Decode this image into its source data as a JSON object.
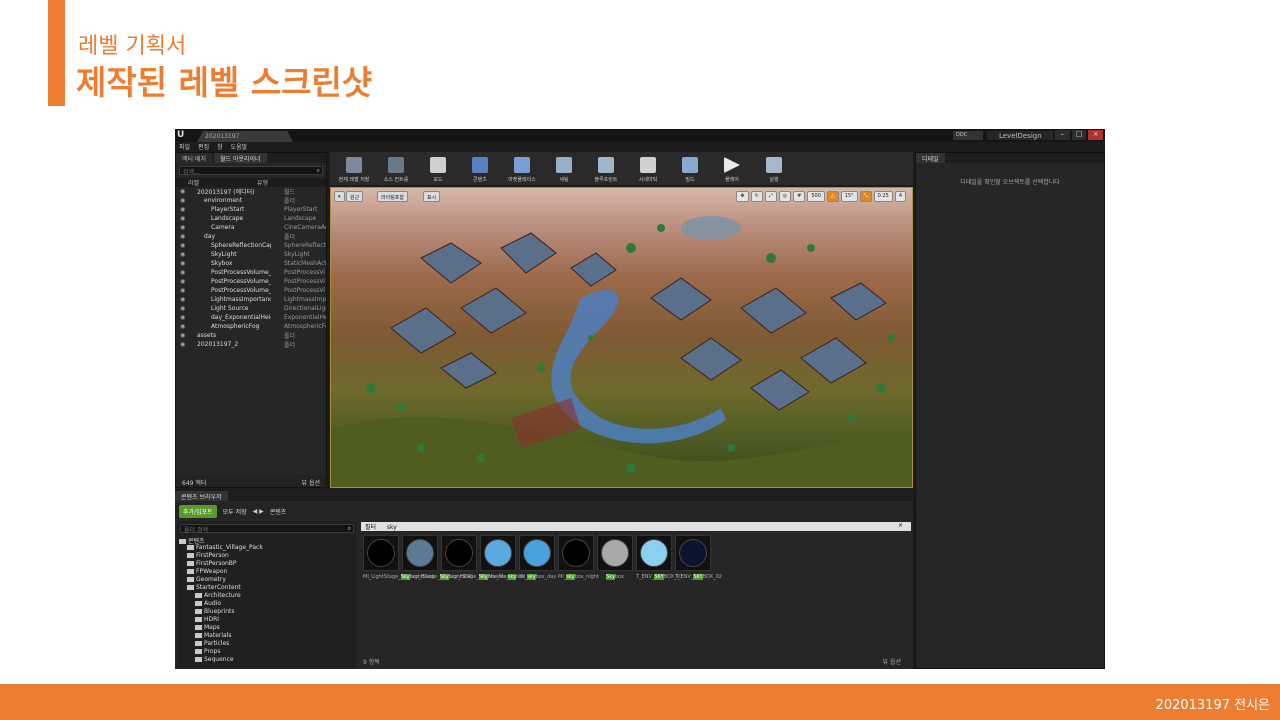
{
  "slide": {
    "subtitle": "레벨 기획서",
    "title": "제작된 레벨 스크린샷",
    "footer": "202013197 전시은",
    "accent_color": "#ed7d31"
  },
  "editor": {
    "tab_title": "202013197",
    "ddc_label": "DDC",
    "project_name": "LevelDesign",
    "menu": [
      "파일",
      "편집",
      "창",
      "도움말"
    ],
    "outliner": {
      "tabs": [
        "액터 배치",
        "월드 아웃라이너"
      ],
      "search_placeholder": "검색...",
      "col_label": "라벨",
      "col_type": "유형",
      "rows": [
        {
          "label": "202013197 (에디터)",
          "type": "월드",
          "indent": 1
        },
        {
          "label": "environment",
          "type": "폴더",
          "indent": 2
        },
        {
          "label": "PlayerStart",
          "type": "PlayerStart",
          "indent": 3
        },
        {
          "label": "Landscape",
          "type": "Landscape",
          "indent": 3
        },
        {
          "label": "Camera",
          "type": "CineCameraAc",
          "indent": 3
        },
        {
          "label": "day",
          "type": "폴더",
          "indent": 2
        },
        {
          "label": "SphereReflectionCapture",
          "type": "SphereReflecti",
          "indent": 3
        },
        {
          "label": "SkyLight",
          "type": "SkyLight",
          "indent": 3
        },
        {
          "label": "Skybox",
          "type": "StaticMeshAct",
          "indent": 3
        },
        {
          "label": "PostProcessVolume_vi",
          "type": "PostProcessVi",
          "indent": 3
        },
        {
          "label": "PostProcessVolume_vi",
          "type": "PostProcessVi",
          "indent": 3
        },
        {
          "label": "PostProcessVolume_L",
          "type": "PostProcessVi",
          "indent": 3
        },
        {
          "label": "LightmassImportanceV",
          "type": "LightmassImpo",
          "indent": 3
        },
        {
          "label": "Light Source",
          "type": "DirectionalLigh",
          "indent": 3
        },
        {
          "label": "day_ExponentialHeigh",
          "type": "ExponentialHei",
          "indent": 3
        },
        {
          "label": "AtmosphericFog",
          "type": "AtmosphericFo",
          "indent": 3
        },
        {
          "label": "assets",
          "type": "폴더",
          "indent": 1
        },
        {
          "label": "202013197_2",
          "type": "폴더",
          "indent": 1
        }
      ],
      "actor_count": "649 액터",
      "view_options": "뷰 옵션"
    },
    "toolbar": [
      "현재 레벨 저장",
      "소스 컨트롤",
      "모드",
      "콘텐츠",
      "마켓플레이스",
      "세팅",
      "블루프린트",
      "시네마틱",
      "빌드",
      "플레이",
      "실행"
    ],
    "viewport": {
      "perspective": "원근",
      "lit": "라이팅포함",
      "show": "표시",
      "grid_snap": "500",
      "rot_snap": "15°",
      "scale_snap": "0.25",
      "camera_speed": "4"
    },
    "details": {
      "tab": "디테일",
      "message": "디테일을 확인할 오브젝트를 선택합니다"
    },
    "content_browser": {
      "tab": "콘텐츠 브라우저",
      "add_import": "추가/임포트",
      "save_all": "모두 저장",
      "path": "콘텐츠",
      "folder_search_placeholder": "폴더 검색",
      "filters_label": "필터",
      "search_value": "sky",
      "folders": [
        {
          "name": "콘텐츠",
          "indent": 0
        },
        {
          "name": "Fantastic_Village_Pack",
          "indent": 1
        },
        {
          "name": "FirstPerson",
          "indent": 1
        },
        {
          "name": "FirstPersonBP",
          "indent": 1
        },
        {
          "name": "FPWeapon",
          "indent": 1
        },
        {
          "name": "Geometry",
          "indent": 1
        },
        {
          "name": "StarterContent",
          "indent": 1
        },
        {
          "name": "Architecture",
          "indent": 2
        },
        {
          "name": "Audio",
          "indent": 2
        },
        {
          "name": "Blueprints",
          "indent": 2
        },
        {
          "name": "HDRI",
          "indent": 2
        },
        {
          "name": "Maps",
          "indent": 2
        },
        {
          "name": "Materials",
          "indent": 2
        },
        {
          "name": "Particles",
          "indent": 2
        },
        {
          "name": "Props",
          "indent": 2
        },
        {
          "name": "Sequence",
          "indent": 2
        }
      ],
      "assets": [
        {
          "pre": "MI_LightStage_",
          "hl": "Sky",
          "post": "box_Black",
          "color": "#000000"
        },
        {
          "pre": "MI_LightStage_",
          "hl": "Sky",
          "post": "box_HDRI",
          "color": "#5a7a95"
        },
        {
          "pre": "MI_LightStage_",
          "hl": "Sky",
          "post": "box_Master",
          "color": "#000000"
        },
        {
          "pre": "MI_Master_",
          "hl": "sky",
          "post": "box_day",
          "color": "#5aaadf"
        },
        {
          "pre": "MI_",
          "hl": "sky",
          "post": "box_day",
          "color": "#4aa0dc"
        },
        {
          "pre": "MI_",
          "hl": "sky",
          "post": "box_night",
          "color": "#000000"
        },
        {
          "pre": "",
          "hl": "Sky",
          "post": "box",
          "color": "#a8a8a8"
        },
        {
          "pre": "T_ENV_",
          "hl": "SKY",
          "post": "BOX_01",
          "color": "#8cd0f0"
        },
        {
          "pre": "T_ENV_",
          "hl": "SKY",
          "post": "BOX_02",
          "color": "#0c1530"
        }
      ],
      "item_count": "9 항목",
      "view_options": "뷰 옵션"
    }
  }
}
